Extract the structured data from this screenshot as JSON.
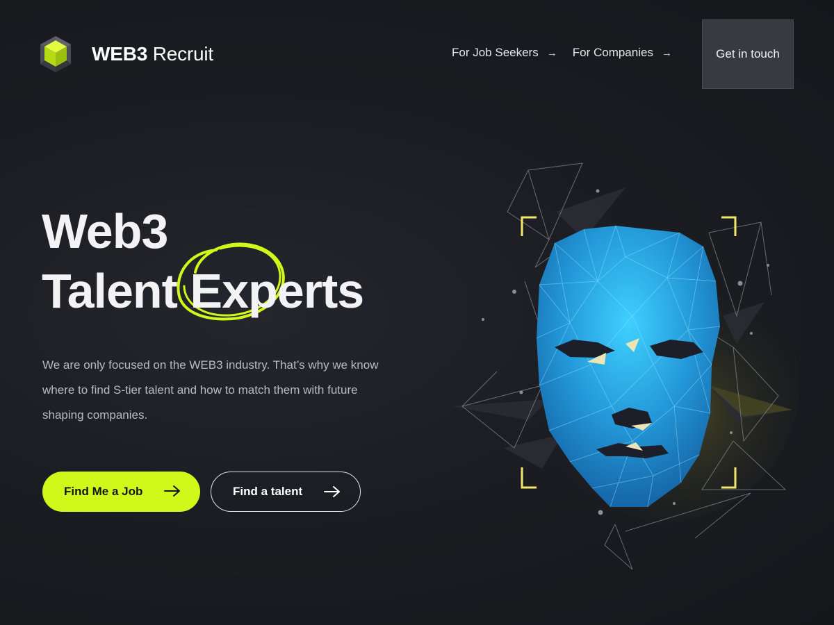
{
  "brand": {
    "name_bold": "WEB3",
    "name_light": "Recruit",
    "accent_color": "#d2f71a",
    "logo_icon": "cube-icon"
  },
  "nav": {
    "items": [
      {
        "label": "For Job Seekers",
        "icon": "arrow-right-icon"
      },
      {
        "label": "For Companies",
        "icon": "arrow-right-icon"
      }
    ],
    "cta_label": "Get in touch"
  },
  "hero": {
    "title_line1": "Web3",
    "title_line2_a": "Talent",
    "title_line2_b": "Experts",
    "description": "We are only focused on the WEB3 industry. That’s why we know where to find S-tier talent and how to match them with future shaping companies.",
    "primary_button": {
      "label": "Find Me a Job",
      "icon": "arrow-right-icon"
    },
    "secondary_button": {
      "label": "Find a talent",
      "icon": "arrow-right-icon"
    },
    "illustration": "polygon-face-illustration"
  },
  "colors": {
    "background": "#1b1d22",
    "face_blue": "#2aa8e8",
    "frame_yellow": "#f3e86a"
  }
}
